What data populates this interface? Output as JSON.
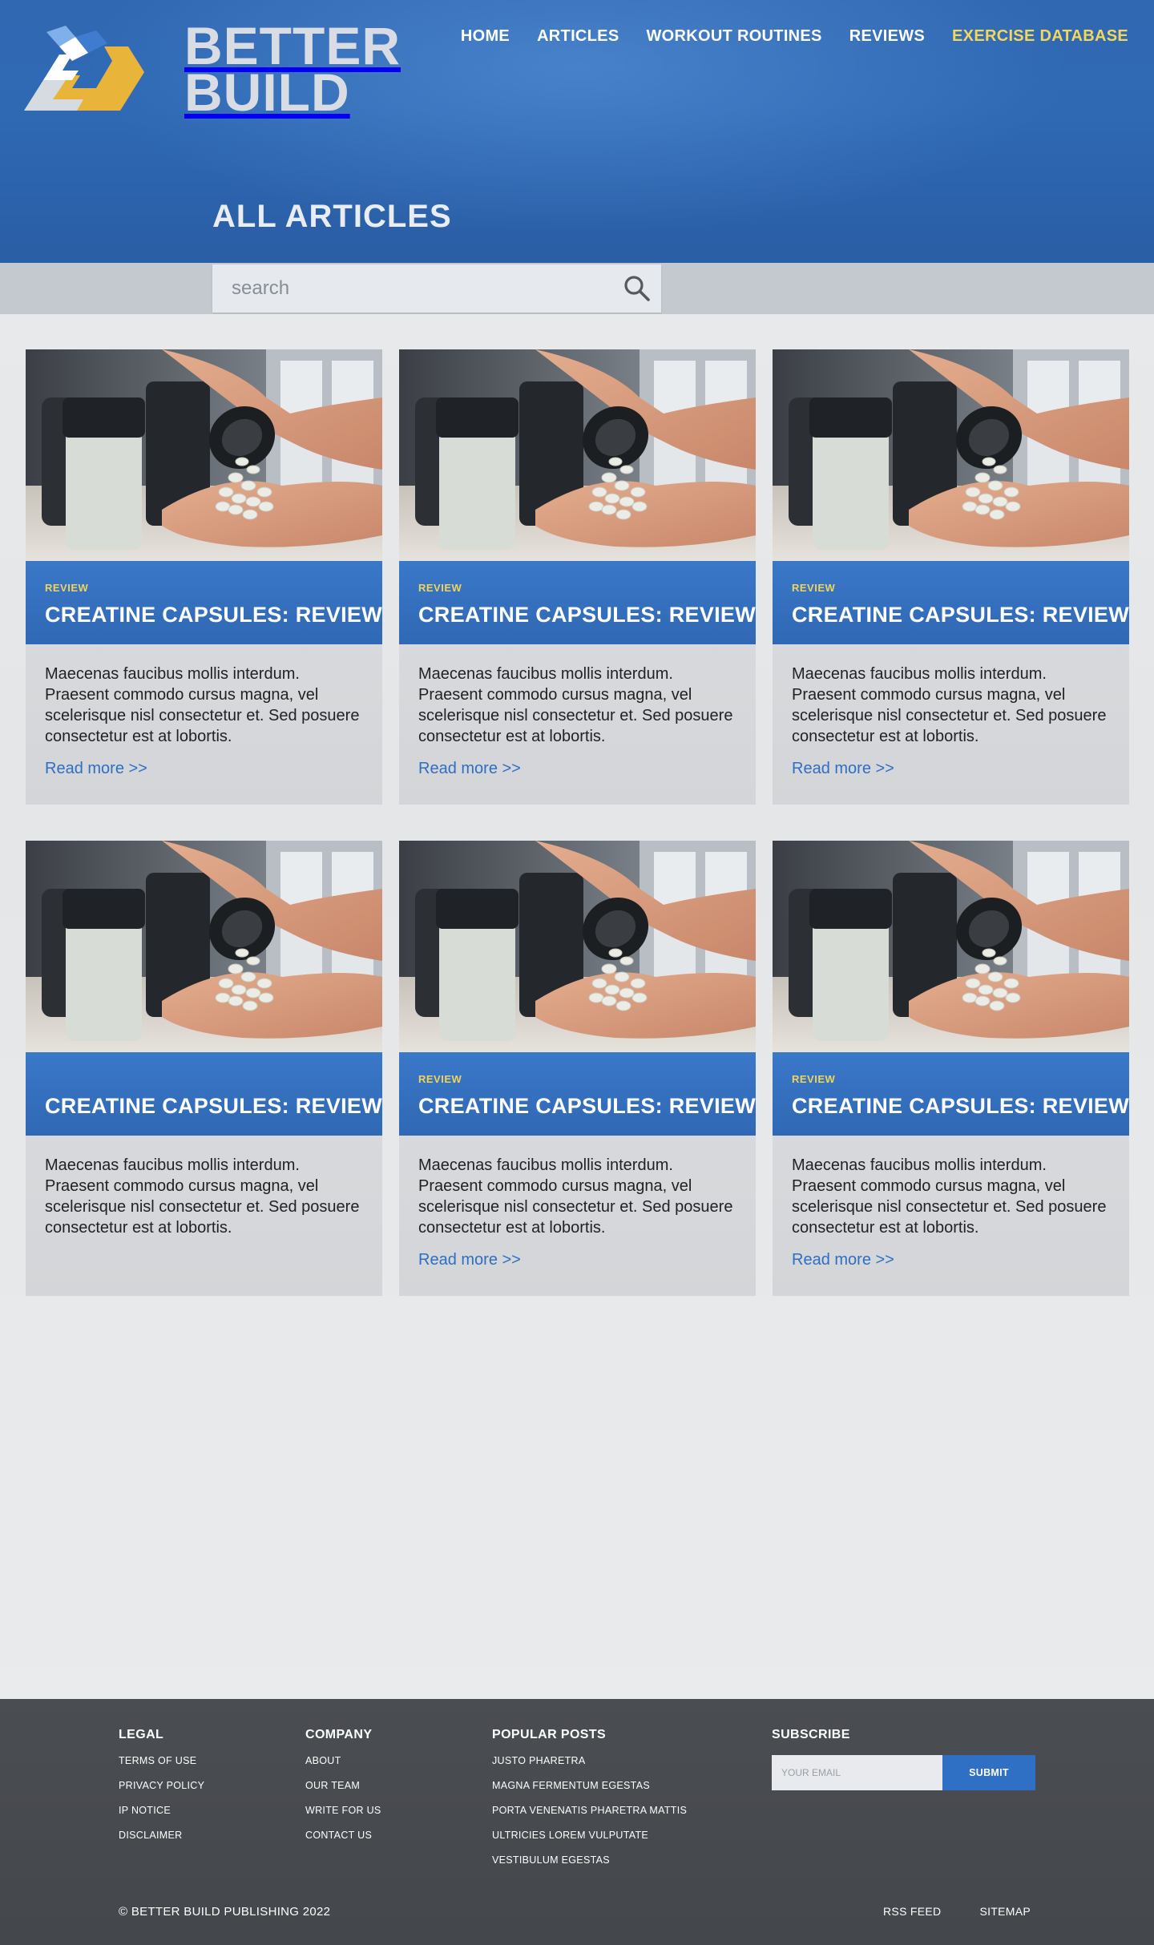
{
  "brand": {
    "name_line1": "BETTER",
    "name_line2": "BUILD"
  },
  "nav": [
    {
      "label": "HOME"
    },
    {
      "label": "ARTICLES"
    },
    {
      "label": "WORKOUT ROUTINES"
    },
    {
      "label": "REVIEWS"
    },
    {
      "label": "EXERCISE DATABASE",
      "active": true
    }
  ],
  "page_title": "ALL ARTICLES",
  "search": {
    "placeholder": "search",
    "value": ""
  },
  "cards": [
    {
      "tag": "REVIEW",
      "title": "CREATINE CAPSULES: REVIEW",
      "text": "Maecenas faucibus mollis interdum. Praesent commodo cursus magna, vel scelerisque nisl consectetur et. Sed posuere consectetur est at lobortis.",
      "link": "Read more >>"
    },
    {
      "tag": "REVIEW",
      "title": "CREATINE CAPSULES: REVIEW",
      "text": "Maecenas faucibus mollis interdum. Praesent commodo cursus magna, vel scelerisque nisl consectetur et. Sed posuere consectetur est at lobortis.",
      "link": "Read more >>"
    },
    {
      "tag": "REVIEW",
      "title": "CREATINE CAPSULES: REVIEW",
      "text": "Maecenas faucibus mollis interdum. Praesent commodo cursus magna, vel scelerisque nisl consectetur et. Sed posuere consectetur est at lobortis.",
      "link": "Read more >>"
    },
    {
      "tag": "",
      "title": "CREATINE CAPSULES: REVIEW",
      "text": "Maecenas faucibus mollis interdum. Praesent commodo cursus magna, vel scelerisque nisl consectetur et. Sed posuere consectetur est at lobortis.",
      "link": ""
    },
    {
      "tag": "REVIEW",
      "title": "CREATINE CAPSULES: REVIEW",
      "text": "Maecenas faucibus mollis interdum. Praesent commodo cursus magna, vel scelerisque nisl consectetur et. Sed posuere consectetur est at lobortis.",
      "link": "Read more >>"
    },
    {
      "tag": "REVIEW",
      "title": "CREATINE CAPSULES: REVIEW",
      "text": "Maecenas faucibus mollis interdum. Praesent commodo cursus magna, vel scelerisque nisl consectetur et. Sed posuere consectetur est at lobortis.",
      "link": "Read more >>"
    }
  ],
  "footer": {
    "legal": {
      "heading": "LEGAL",
      "items": [
        "TERMS OF USE",
        "PRIVACY POLICY",
        "IP NOTICE",
        "DISCLAIMER"
      ]
    },
    "company": {
      "heading": "COMPANY",
      "items": [
        "ABOUT",
        "OUR TEAM",
        "WRITE FOR US",
        "CONTACT US"
      ]
    },
    "popular": {
      "heading": "POPULAR POSTS",
      "items": [
        "JUSTO PHARETRA",
        "MAGNA FERMENTUM EGESTAS",
        "PORTA VENENATIS PHARETRA MATTIS",
        "ULTRICIES LOREM VULPUTATE",
        "VESTIBULUM EGESTAS"
      ]
    },
    "subscribe": {
      "heading": "SUBSCRIBE",
      "placeholder": "YOUR EMAIL",
      "button": "SUBMIT"
    },
    "copyright": "© BETTER BUILD PUBLISHING 2022",
    "links": [
      "RSS FEED",
      "SITEMAP"
    ]
  },
  "colors": {
    "primary_blue": "#2f69b4",
    "accent_yellow": "#f3d75a",
    "footer_bg": "#4a4d52",
    "link_blue": "#2e6fc2"
  }
}
